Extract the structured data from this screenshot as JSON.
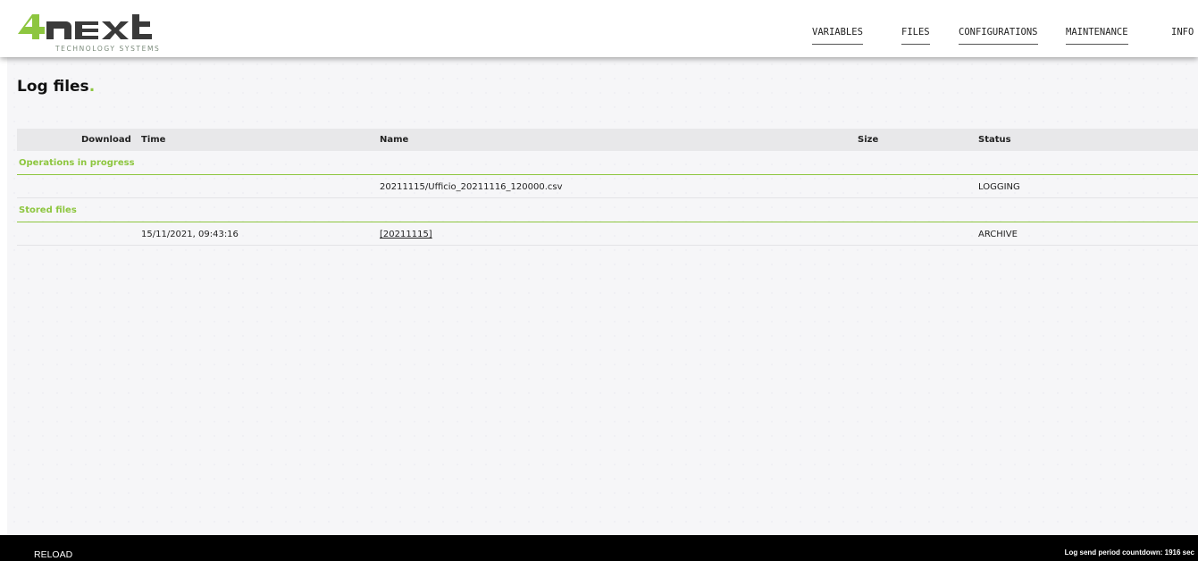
{
  "brand": {
    "logo_text": "4next",
    "logo_subtitle": "TECHNOLOGY SYSTEMS",
    "accent_color": "#8dc63f"
  },
  "nav": {
    "items": [
      "VARIABLES",
      "FILES",
      "CONFIGURATIONS",
      "MAINTENANCE",
      "INFO"
    ]
  },
  "page": {
    "title": "Log files",
    "title_dot": "."
  },
  "table": {
    "headers": {
      "download": "Download",
      "time": "Time",
      "name": "Name",
      "size": "Size",
      "status": "Status"
    },
    "groups": [
      {
        "label": "Operations in progress",
        "rows": [
          {
            "time": "",
            "name": "20211115/Ufficio_20211116_120000.csv",
            "name_link": false,
            "size": "",
            "status": "LOGGING"
          }
        ]
      },
      {
        "label": "Stored files",
        "rows": [
          {
            "time": "15/11/2021, 09:43:16",
            "name": "[20211115]",
            "name_link": true,
            "size": "",
            "status": "ARCHIVE"
          }
        ]
      }
    ]
  },
  "footer": {
    "reload_label": "RELOAD",
    "countdown_text": "Log send period countdown: 1916 sec"
  }
}
